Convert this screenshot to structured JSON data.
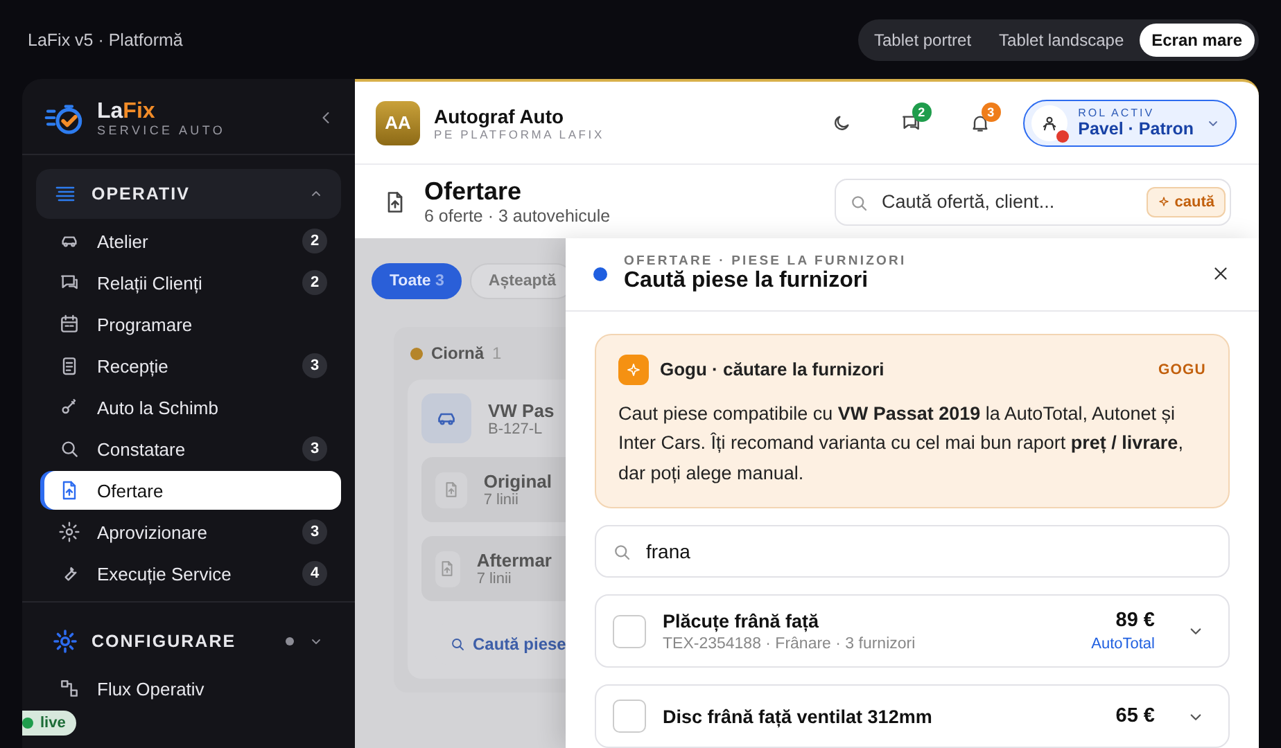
{
  "app": {
    "title": "LaFix v5 · Platformă"
  },
  "view_modes": [
    {
      "label": "Tablet portret",
      "selected": false
    },
    {
      "label": "Tablet landscape",
      "selected": false
    },
    {
      "label": "Ecran mare",
      "selected": true
    }
  ],
  "sidebar": {
    "brand": {
      "name_part_1": "La",
      "name_part_2": "Fix",
      "subtitle": "SERVICE AUTO"
    },
    "sections": [
      {
        "title": "OPERATIV",
        "expanded": true,
        "items": [
          {
            "label": "Atelier",
            "badge": "2",
            "selected": false
          },
          {
            "label": "Relații Clienți",
            "badge": "2",
            "selected": false
          },
          {
            "label": "Programare",
            "selected": false
          },
          {
            "label": "Recepție",
            "badge": "3",
            "selected": false
          },
          {
            "label": "Auto la Schimb",
            "selected": false
          },
          {
            "label": "Constatare",
            "badge": "3",
            "selected": false
          },
          {
            "label": "Ofertare",
            "selected": true
          },
          {
            "label": "Aprovizionare",
            "badge": "3",
            "selected": false
          },
          {
            "label": "Execuție Service",
            "badge": "4",
            "selected": false
          }
        ]
      },
      {
        "title": "CONFIGURARE",
        "expanded": false,
        "items": [
          {
            "label": "Flux Operativ",
            "selected": false
          }
        ]
      }
    ],
    "live": {
      "label": "live"
    }
  },
  "header": {
    "workspace": {
      "initials": "AA",
      "name": "Autograf Auto",
      "subtitle": "PE PLATFORMA LAFIX"
    },
    "messages_badge": "2",
    "notifications_badge": "3",
    "user": {
      "role_label": "ROL ACTIV",
      "name": "Pavel · Patron"
    }
  },
  "page": {
    "title": "Ofertare",
    "subtitle": "6 oferte · 3 autovehicule",
    "search": {
      "placeholder": "Caută ofertă, client...",
      "button": "caută"
    }
  },
  "board": {
    "filters": [
      {
        "label": "Toate",
        "count": "3",
        "selected": true
      },
      {
        "label": "Așteaptă",
        "selected": false
      }
    ],
    "column": {
      "title": "Ciornă",
      "count": "1"
    },
    "card": {
      "vehicle": "VW Pas",
      "plate": "B-127-L",
      "offers": [
        {
          "name": "Original",
          "lines": "7 linii"
        },
        {
          "name": "Aftermar",
          "lines": "7 linii"
        }
      ],
      "button": "Caută piese"
    }
  },
  "drawer": {
    "overline": "OFERTARE · PIESE LA FURNIZORI",
    "title": "Caută piese la furnizori",
    "assistant": {
      "title": "Gogu · căutare la furnizori",
      "tag": "GOGU",
      "message": "Caut piese compatibile cu **VW Passat 2019** la AutoTotal, Autonet și Inter Cars. Îți recomand varianta cu cel mai bun raport **preț / livrare**, dar poți alege manual."
    },
    "search": {
      "value": "frana"
    },
    "results": [
      {
        "name": "Plăcuțe frână față",
        "meta": "TEX-2354188 · Frânare · 3 furnizori",
        "price": "89 €",
        "supplier": "AutoTotal",
        "checked": false,
        "expanded": false
      },
      {
        "name": "Disc frână față ventilat 312mm",
        "price": "65 €",
        "checked": false,
        "expanded": false
      }
    ]
  }
}
